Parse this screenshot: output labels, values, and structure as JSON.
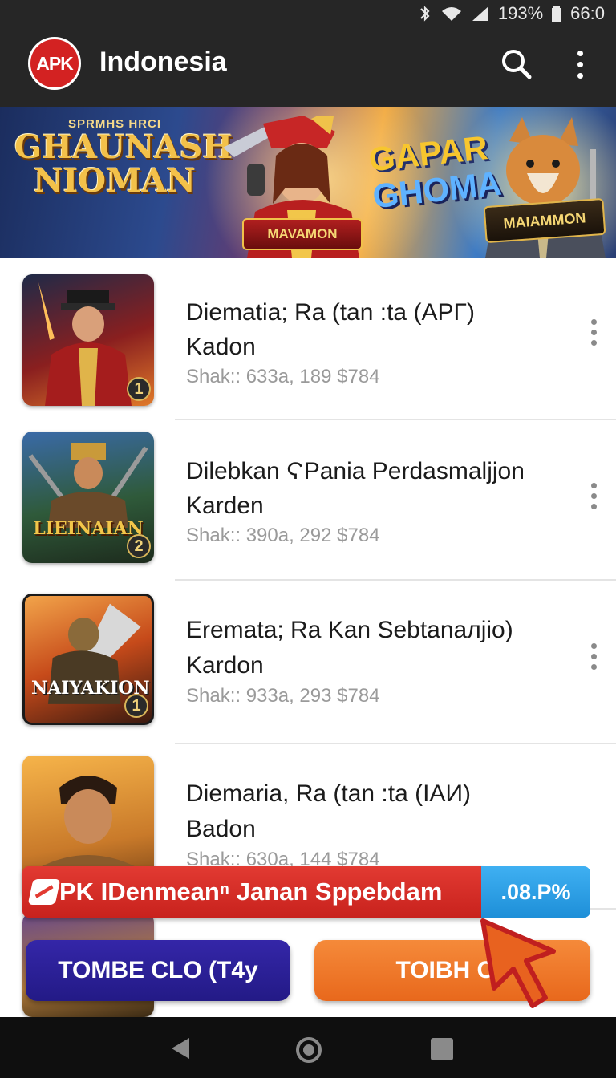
{
  "status_bar": {
    "battery": "193%",
    "time": "66:0"
  },
  "app_bar": {
    "logo": "APK",
    "title": "Indonesia"
  },
  "banner": {
    "kicker": "SPRMHS HRCI",
    "title_line1": "GHAUNASH",
    "title_line2": "NIOMAN",
    "center_badge": "MAVAMON",
    "right_title_line1": "GAPAR",
    "right_title_line2": "GHOMA",
    "right_badge": "MAIAMMON"
  },
  "apps": [
    {
      "title": "Diematia; Ra (tan :ta (APΓ)",
      "subtitle_line": "Kadon",
      "meta": "Shak:: 633a,  189 $784",
      "rank": "1",
      "thumb_label": ""
    },
    {
      "title": "Dilebkan ϚPania Perdasmaljjon",
      "subtitle_line": "Karden",
      "meta": "Shak:: 390a,  292 $784",
      "rank": "2",
      "thumb_label": "LIEINAIAN"
    },
    {
      "title": "Erematа; Ra Kan Sebtanaлjio)",
      "subtitle_line": "Kardon",
      "meta": "Shak:: 933a,  293 $784",
      "rank": "1",
      "thumb_label": "NAIYAKION"
    },
    {
      "title": "Diemaria, Ra (tan :ta (IAИ)",
      "subtitle_line": "Badon",
      "meta": "Shak:: 630a,  144 $784",
      "rank": "",
      "thumb_label": ""
    }
  ],
  "promo": {
    "text": "PK IDenmeanⁿ  Janan Sppebdam",
    "pill": ".08.P%"
  },
  "buttons": {
    "left": "TOMBE CLO (T4y",
    "right": "TOIBH CL"
  },
  "colors": {
    "app_bar": "#262626",
    "logo_red": "#d32222",
    "promo_red": "#d62b25",
    "promo_blue": "#2a9ee6",
    "btn_left": "#2b1f97",
    "btn_right": "#ef7a2a"
  }
}
